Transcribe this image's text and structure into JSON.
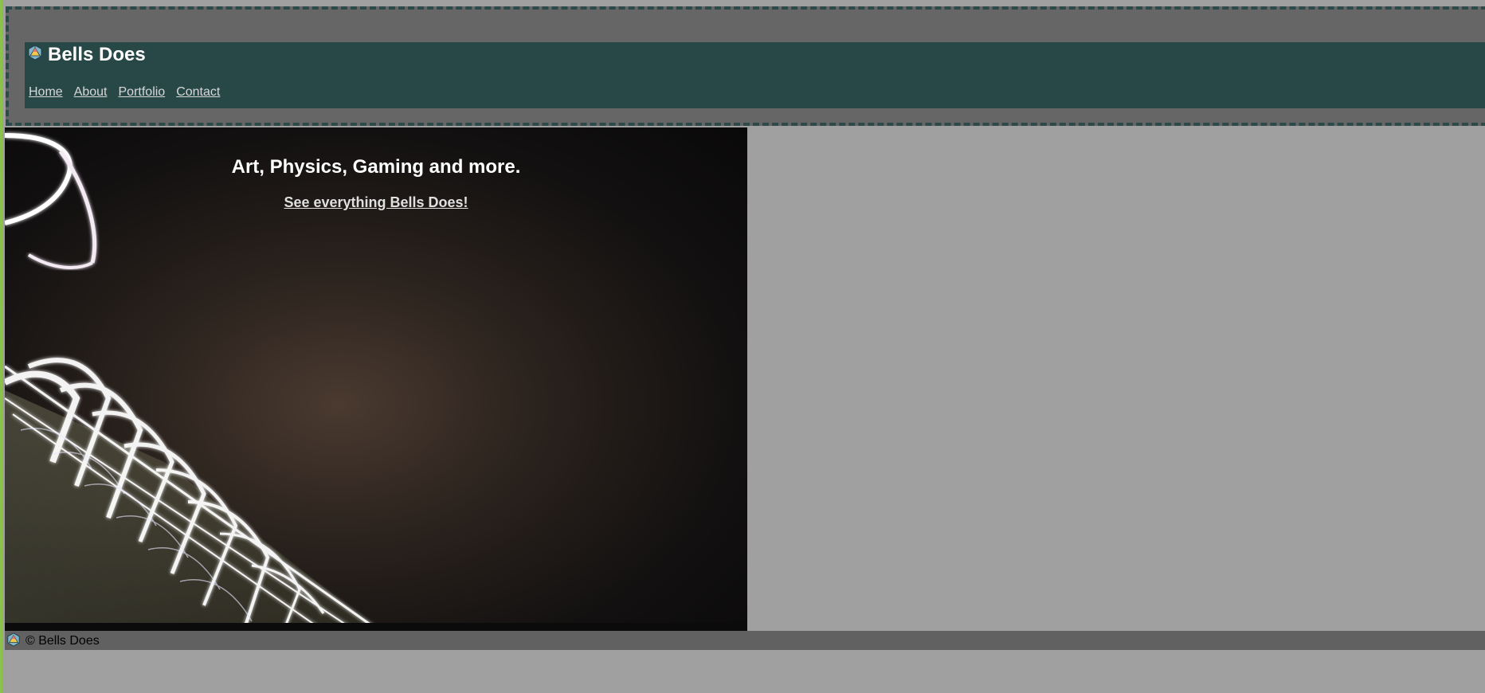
{
  "site": {
    "title": "Bells Does",
    "logo_icon": "d20-dice-icon"
  },
  "nav": {
    "items": [
      {
        "label": "Home"
      },
      {
        "label": "About"
      },
      {
        "label": "Portfolio"
      },
      {
        "label": "Contact"
      }
    ]
  },
  "hero": {
    "heading": "Art, Physics, Gaming and more.",
    "link_label": "See everything Bells Does!",
    "background": "light-painting-photo"
  },
  "footer": {
    "text": "© Bells Does",
    "icon": "d20-dice-icon"
  },
  "colors": {
    "header_bar": "#284848",
    "header_border": "#2d4a4a",
    "page_bg": "#a0a0a0",
    "footer_bg": "#616161",
    "accent_left": "#8bc34a"
  }
}
